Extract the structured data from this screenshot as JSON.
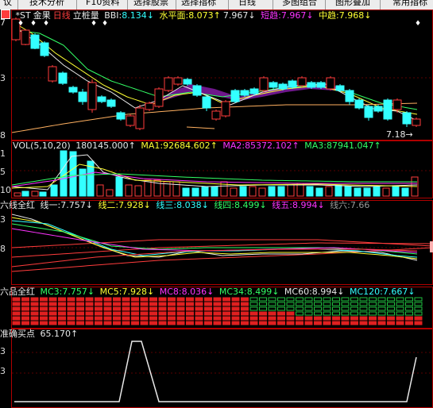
{
  "toolbar": {
    "items": [
      "议",
      "技术分析",
      "F10资料",
      "选择股票",
      "选择指标",
      "日线",
      "多图组合",
      "图形叠加",
      "常用指标"
    ]
  },
  "main_panel": {
    "icon": "stock-icon",
    "stock_code": "*ST",
    "stock_name": "金果",
    "period": "日线",
    "indicator": "立桩量",
    "bbi_label": "BBI:",
    "bbi_value": "8.134↓",
    "level_label": "水平面:",
    "level_value": "8.073↑",
    "level_extra": "7.967↓",
    "short_label": "短趋:",
    "short_value": "7.967↓",
    "mid_label": "中趋:",
    "mid_value": "7.968↓",
    "y_labels": [
      "7",
      "3",
      "8"
    ],
    "price_marker": "7.18"
  },
  "vol_panel": {
    "title": "VOL(5,10,20)",
    "vol_value": "180145.000↑",
    "ma1_label": "MA1:",
    "ma1_value": "92684.602↑",
    "ma2_label": "MA2:",
    "ma2_value": "85372.102↑",
    "ma3_label": "MA3:",
    "ma3_value": "87941.047↑",
    "y_labels": [
      "1",
      "5",
      "10"
    ]
  },
  "six_line_panel": {
    "title": "六线全红",
    "line1_label": "线一:",
    "line1_value": "7.757↓",
    "line2_label": "线二:",
    "line2_value": "7.928↓",
    "line3_label": "线三:",
    "line3_value": "8.038↓",
    "line4_label": "线四:",
    "line4_value": "8.499↓",
    "line5_label": "线五:",
    "line5_value": "8.994↓",
    "line6_label": "线六:",
    "line6_value": "7.66",
    "y_labels": [
      "3",
      "8"
    ]
  },
  "six_product_panel": {
    "title": "六品全红",
    "mc3_label": "MC3:",
    "mc3_value": "7.757↓",
    "mc5_label": "MC5:",
    "mc5_value": "7.928↓",
    "mc8_label": "MC8:",
    "mc8_value": "8.036↓",
    "mc34_label": "MC34:",
    "mc34_value": "8.499↓",
    "mc60_label": "MC60:",
    "mc60_value": "8.994↓",
    "mc120_label": "MC120:",
    "mc120_value": "7.667↓"
  },
  "buy_panel": {
    "title": "准确买点",
    "value": "65.170↑",
    "y_labels": [
      "3",
      "3"
    ]
  },
  "colors": {
    "up": "#ff3c3c",
    "down": "#33ffff",
    "ma_yellow": "#ffff33",
    "ma_magenta": "#ff33ff",
    "ma_green": "#33ff66",
    "ma_white": "#e8e8e8",
    "panel_border": "#b00000",
    "fill_purple": "#7a1a9a"
  }
}
